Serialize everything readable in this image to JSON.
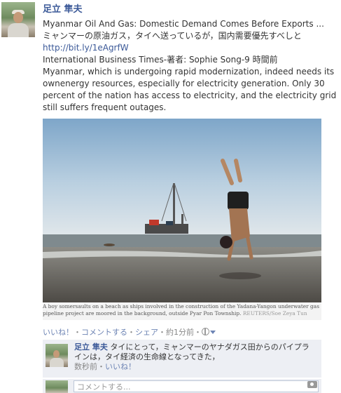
{
  "post": {
    "author": "足立 隼夫",
    "article_title": "Myanmar Oil And Gas: Domestic Demand Comes Before Exports ...",
    "jp_summary": "ミャンマーの原油ガス，タイへ送っているが，国内需要優先すべしと",
    "link": "http://bit.ly/1eAgrfW",
    "source_line": "International Business Times-著者: Sophie Song-9 時間前",
    "description": "Myanmar, which is undergoing rapid modernization, indeed needs its ownenergy resources, especially for electricity generation. Only 30 percent of the nation has access to electricity, and the electricity grid still suffers frequent outages.",
    "photo_caption": "A boy somersaults on a beach as ships involved in the construction of the Yadana-Yangon underwater gas pipeline project are moored in the background, outside Pyar Pon Township.",
    "photo_credit": "REUTERS/Soe Zeya Tun"
  },
  "actions": {
    "like": "いいね！",
    "comment": "コメントする",
    "share": "シェア",
    "time": "約1分前",
    "separator": "・",
    "audience_icon": "globe-icon"
  },
  "comment": {
    "author": "足立 隼夫",
    "text": "タイにとって，ミャンマーのヤナダガス田からのパイプラインは，タイ経済の生命線となってきた，",
    "time": "数秒前",
    "like": "いいね！"
  },
  "reply": {
    "placeholder": "コメントする...",
    "attach_icon": "camera-icon"
  },
  "colors": {
    "link": "#3b5998",
    "action": "#6d84b4",
    "comment_bg": "#edeff4"
  }
}
